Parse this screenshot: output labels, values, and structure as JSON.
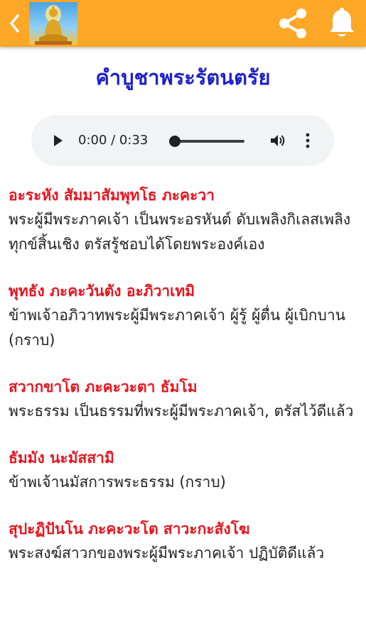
{
  "colors": {
    "appbar": "#ffa726",
    "title": "#1e21c9",
    "pali_text": "#e8141e",
    "translation_text": "#222222",
    "audio_bg": "#f1f3f4"
  },
  "header": {
    "back_icon": "chevron-left-icon",
    "logo": "buddha-statue-logo",
    "share_icon": "share-icon",
    "notification_icon": "bell-icon"
  },
  "page": {
    "title": "คำบูชาพระรัตนตรัย"
  },
  "audio_player": {
    "time": "0:00 / 0:33",
    "progress": 0,
    "icons": [
      "play-icon",
      "volume-icon",
      "more-vert-icon"
    ]
  },
  "verses": [
    {
      "pali": "อะระหัง สัมมาสัมพุทโธ ภะคะวา",
      "translation": "พระผู้มีพระภาคเจ้า เป็นพระอรหันต์ ดับเพลิงกิเลสเพลิงทุกข์สิ้นเชิง ตรัสรู้ชอบได้โดยพระองค์เอง"
    },
    {
      "pali": "พุทธัง ภะคะวันตัง อะภิวาเทมิ",
      "translation": "ข้าพเจ้าอภิวาทพระผู้มีพระภาคเจ้า ผู้รู้ ผู้ตื่น ผู้เบิกบาน (กราบ)"
    },
    {
      "pali": "สวากขาโต ภะคะวะตา ธัมโม",
      "translation": "พระธรรม เป็นธรรมที่พระผู้มีพระภาคเจ้า, ตรัสไว้ดีแล้ว"
    },
    {
      "pali": "ธัมมัง นะมัสสามิ",
      "translation": "ข้าพเจ้านมัสการพระธรรม (กราบ)"
    },
    {
      "pali": "สุปะฏิปันโน ภะคะวะโต สาวะกะสังโฆ",
      "translation": "พระสงฆ์สาวกของพระผู้มีพระภาคเจ้า ปฏิบัติดีแล้ว"
    }
  ]
}
